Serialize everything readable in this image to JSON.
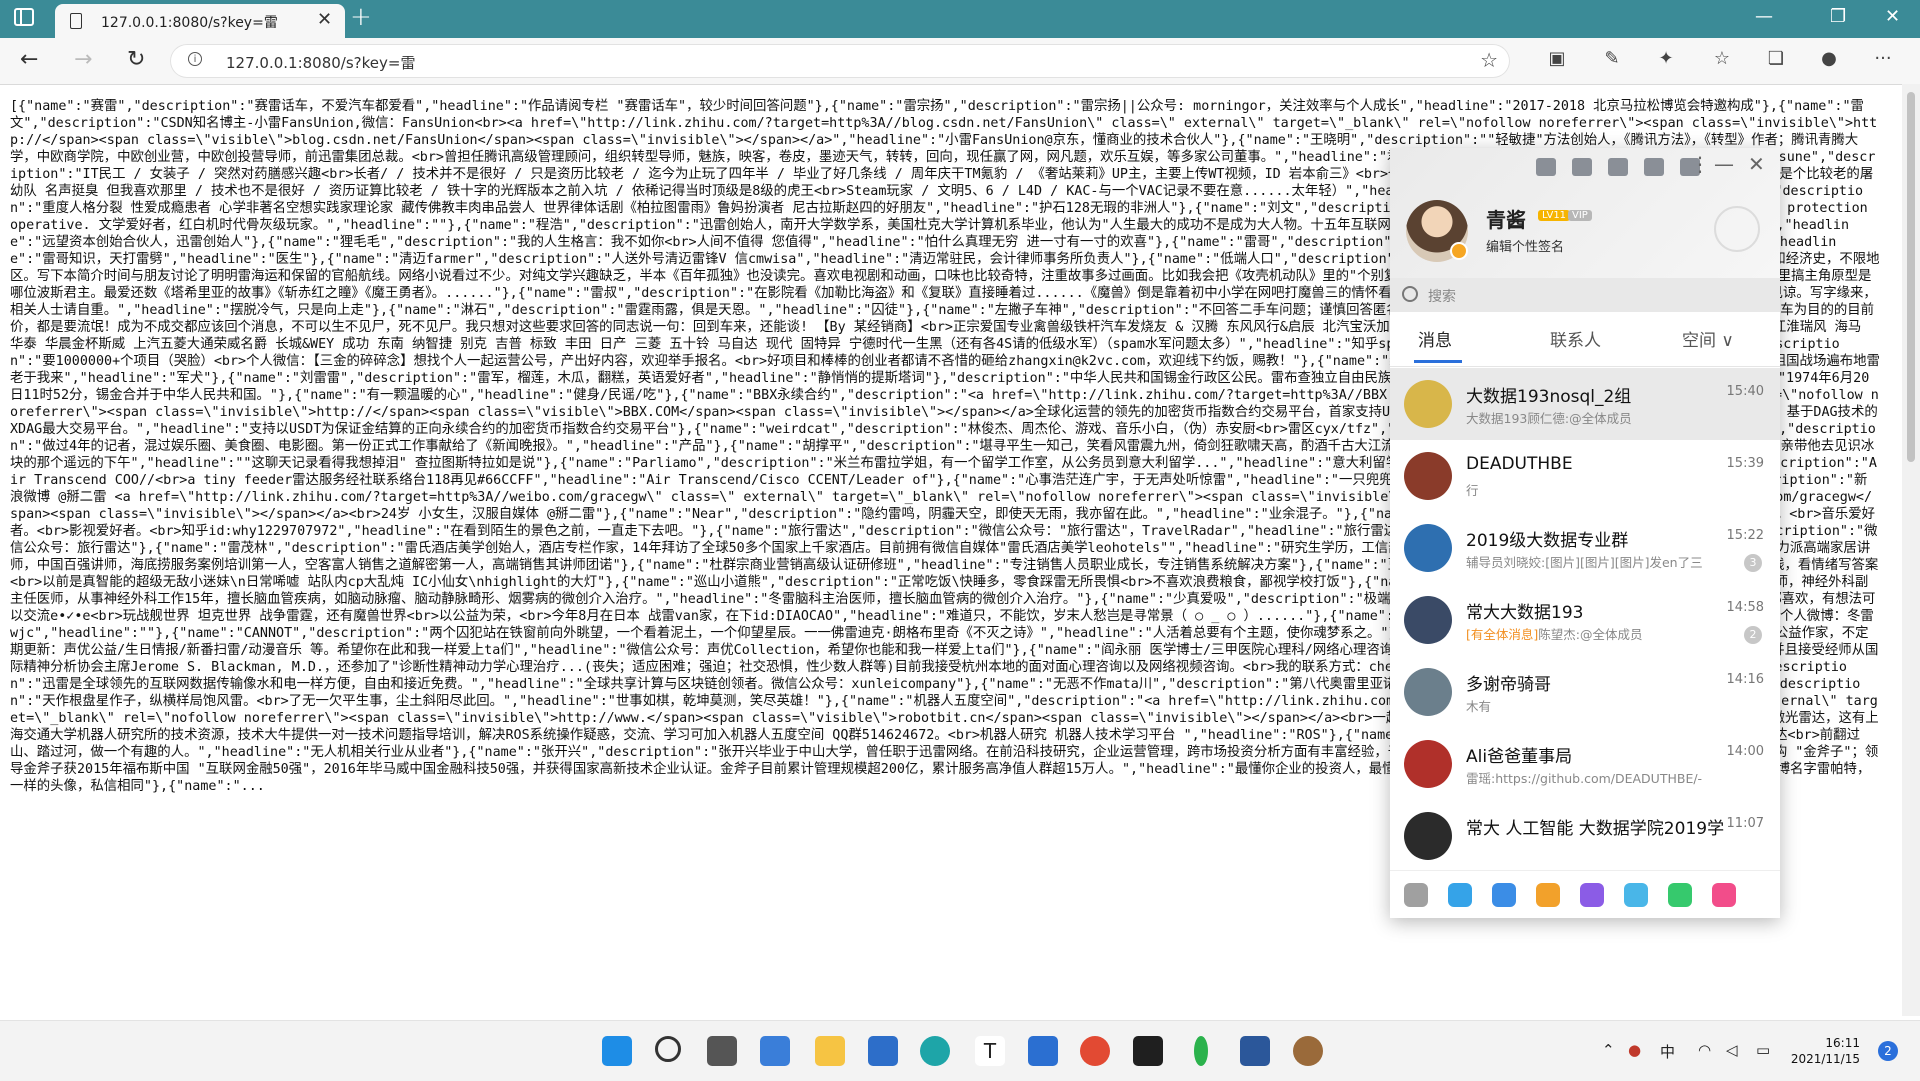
{
  "browser": {
    "tab_title": "127.0.0.1:8080/s?key=雷",
    "tab_close": "✕",
    "new_tab": "+",
    "url": "127.0.0.1:8080/s?key=雷",
    "minimize": "—",
    "maximize": "❐",
    "close": "✕",
    "back": "←",
    "forward": "→",
    "reload": "↻",
    "menu": "···"
  },
  "page": {
    "text": "[{\"name\":\"赛雷\",\"description\":\"赛雷话车，不爱汽车都爱看\",\"headline\":\"作品请阅专栏 \"赛雷话车\"，较少时间回答问题\"},{\"name\":\"雷宗扬\",\"description\":\"雷宗扬||公众号: morningor，关注效率与个人成长\",\"headline\":\"2017-2018 北京马拉松博览会特邀构成\"},{\"name\":\"雷文\",\"description\":\"CSDN知名博主-小雷FansUnion,微信：FansUnion<br><a href=\\\"http://link.zhihu.com/?target=http%3A//blog.csdn.net/FansUnion\\\" class=\\\" external\\\" target=\\\"_blank\\\" rel=\\\"nofollow noreferrer\\\"><span class=\\\"invisible\\\">http://</span><span class=\\\"visible\\\">blog.csdn.net/FansUnion</span><span class=\\\"invisible\\\"></span></a>\",\"headline\":\"小雷FansUnion@京东，懂商业的技术合伙人\"},{\"name\":\"王晓明\",\"description\":\"\"轻敏捷\"方法创始人，《腾讯方法》，《转型》作者；腾讯青腾大学，中欧商学院，中欧创业营，中欧创投营导师，前迅雷集团总裁。<br>曾担任腾讯高级管理顾问，组织转型导师，魅族，映客，卷皮，墨迹天气，转转，回向，现任赢了网，网凡题，欢乐互娱，等多家公司董事。\",\"headline\":\"君武资本 创始人，敏思特咨询 创始人\"},{\"name\":\"SandoKitsune\",\"description\":\"IT民工 / 女装子 / 突然对药膳感兴趣<br>长者/ / 技术并不是很好 / 只是资历比较老 / 迄今为止玩了四年半 / 毕业了好几条线 / 周年庆干TM氪豹 / 《奢站莱莉》UP主，主要上传WT视频，ID 岩本俞三》<br>也玩WOT / 南区北区都有号 / 南区KSAAC战队招募员 / 少先队是个比较老的屠幼队 名声挺臭 但我喜欢那里 / 技术也不是很好 / 资历证算比较老 / 铁十字的光辉版本之前入坑 / 依稀记得当时顶级是8级的虎王<br>Steam玩家 / 文明5、6 / L4D / KAC-与一个VAC记录不要在意......太年轻）\",\"headline\":\"网络工程师、女装子、WT玩家\"},{\"name\":\"拉兹\",\"description\":\"重度人格分裂 性爱成瘾患者 心学非著名空想实践家理论家 藏传佛教丰肉串品尝人 世界律体话剧《柏拉图雷雨》鲁妈扮演者 尼古拉斯赵四的好朋友\",\"headline\":\"护石128无瑕的非洲人\"},{\"name\":\"刘文\",\"description\":\"工程博士，力量举爱好者，巴西柔术蓝带，格雷西巴西柔术 protection operative. 文学爱好者，红白机时代骨灰级玩家。\",\"headline\":\"\"},{\"name\":\"程浩\",\"description\":\"迅雷创始人，南开大学数学系，美国杜克大学计算机系毕业，他认为\"人生最大的成功不是成为大人物。十五年互联网经验，现在从事科技行业的风险投资，目标打造下一支\"红杉\"。\",\"headline\":\"远望资本创始合伙人，迅雷创始人\"},{\"name\":\"狸毛毛\",\"description\":\"我的人生格言：我不如你<br>人间不值得 您值得\",\"headline\":\"怕什么真理无穷 进一寸有一寸的欢喜\"},{\"name\":\"雷哥\",\"description\":\"追求风一样自由，追求雨一样的任性，追求雷一样的轰鸣。\",\"headline\":\"雷哥知识，天打雷劈\",\"headline\":\"医生\"},{\"name\":\"清迈farmer\",\"description\":\"人送外号清迈雷锋V 信cmwisa\",\"headline\":\"清迈常驻民，会计律师事务所负责人\"},{\"name\":\"低端人口\",\"description\":\"半死不活，过几年玩科学和科幻世界。较偏好制度史，边疆史和经济史，不限地区。写下本简介时间与朋友讨论了明明雷海运和保留的官船航线。网络小说看过不少。对纯文学兴趣缺乏，半本《百年孤独》也没读完。喜欢电视剧和动画，口味也比较奇特，注重故事多过画面。比如我会把《攻壳机动队》里的\"个别复杂\"行为和现实中的 \"独狼\"袭击作类比，会在《亚尔斯兰战记》里搞主角原型是哪位波斯君主。最爱还数《塔希里亚的故事》《斩赤红之瞳》《魔王勇者》。......",
    "text2": "\"},{\"name\":\"雷叔\",\"description\":\"在影院看《加勒比海盗》和《复联》直接睡着过......《魔兽》倒是靠着初中小学在网吧打魔兽三的情怀看完了。<br>        本人说真的，想到哪写到哪，文白夹杂，见谅。写字缘来，相关人士请自重。\",\"headline\":\"摆脱冷气，只是向上走\"},{\"name\":\"淋石\",\"description\":\"雷霆雨露，俱是天恩。\",\"headline\":\"囚徒\"},{\"name\":\"左撇子车神\",\"description\":\"不回答二手车问题；谨慎回答匿名提问；别乱邀请我回答问题哈哈\",\"headline\":\"自目前为止订车为目的的目前价，都是要流氓！成为不成交都应该回个消息，不可以生不见尸，死不见尸。我只想对这些要求回答的同志说一句：回到车来，还能谈! 【By 某经销商】<br>正宗爱国专业禽兽级铁杆汽车发烧友 & 汉腾 东风风行&启辰 北汽宝沃加速威望欧美 吉利&领克 长安&DS 比亚迪&腾势 传祺 川汽野马 江淮瑞风 海马 华泰 华晨金杯斯威 上汽五菱大通荣威名爵 长城&WEY 成功 东南 纳智捷 别克 吉普 标致 丰田 日产 三菱 五十铃 马自达 现代 固特异 宁德时代一生黑（还有各4S请的低级水军）（spam水军问题太多）\",\"headline\":\"知乎spam清道夫，被上汽公关怼封号好几次\"},{\"name\":\"张森\",\"description\":\"要1000000+个项目（哭脸）<br>个人微信：【三金的碎碎念】想找个人一起运营公号，产出好内容，欢迎举手报名。<br>好项目和棒棒的创业者都请不吝惜的砸给zhangxin@k2vc.com，欢迎线下约饭，赐教！\"},{\"name\":\"维尼\",\"description\":\"图私和前线铺满黄金孙子才去<br>为祖国战场遍布地雷老于我来\",\"headline\":\"军犬\"},{\"name\":\"刘雷雷\",\"description\":\"雷军，榴莲，木瓜，翻糕，英语爱好者\",\"headline\":\"静悄悄的提斯塔词\"},\"description\":\"中华人民共和国锡金行政区公民。雷布查独立自由民族复兴党党员。Jarnail Singh Bhindranwal\",\"headline\":\"1974年6月20日11时52分，锡金合并于中华人民共和国。\"},{\"name\":\"有一颗温暖的心\",\"headline\":\"健身/民谣/吃\"},{\"name\":\"BBX永续合约\",\"description\":\"<a href=\\\"http://link.zhihu.com/?target=http%3A//BBX.COM\\\" class=\\\" external\\\" target=\\\"_blank\\\" rel=\\\"nofollow noreferrer\\\"><span class=\\\"invisible\\\">http://</span><span class=\\\"visible\\\">BBX.COM</span><span class=\\\"invisible\\\"></span></a>全球化运营的领先的加密货币指数合约交易平台，首家支持USDT做为保证金的币种永续合约交易平台。同时也是迅雷链克LTK、基于DAG技术的XDAG最大交易平台。\",\"headline\":\"支持以USDT为保证金结算的正向永续合约的加密货币指数合约交易平台\"},{\"name\":\"weirdcat\",\"description\":\"林俊杰、周杰伦、游戏、音乐小白，（伪）赤安厨<br>雷区cyx/tfz\",\"headline\":\"林吹/打粉/拉吹/透厨\"},{\"name\":\"晓云coco\",\"description\":\"做过4年的记者，混过娱乐圈、美食圈、电影圈。第一份正式工作事献给了《新闻晚报》。\",\"headline\":\"产品\"},{\"name\":\"胡撑平\",\"description\":\"堪寻平生一知己，笑看风雷震九州，倚剑狂歌啸天高，酌酒千古大江流。\"},{\"name\":\"柏林，奥里雷亚诺.布恩迪亚上校将会回想起父亲带他去见识冰块的那个遥远的下午\",\"headline\":\"\"这聊天记录看得我想掉泪\" 查拉图斯特拉如是说\"},{\"name\":\"Parliamo\",\"description\":\"米兰布雷拉学姐，有一个留学工作室，从公务员到意大利留学...\",\"headline\":\"意大利留学|图兰朵计划|马可波罗计划|国际生\"},{\"name\":\"cyq\",\"description\":\"Air Transcend COO//<br>a tiny feeder雷达服务经社联系络台118再见#66CCFF\",\"headline\":\"Air Transcend/Cisco CCENT/Leader of\"},{\"name\":\"心事浩茫连广宇，于无声处听惊雷\",\"headline\":\"一只兜兜转转实现了人生梦想的理工文青\"},{\"name\":\"掰二雷\",\"description\":\"新浪微博 @掰二雷 <a href=\\\"http://link.zhihu.com/?target=http%3A//weibo.com/gracegw\\\" class=\\\" external\\\" target=\\\"_blank\\\" rel=\\\"nofollow noreferrer\\\"><span class=\\\"invisible\\\">http://</span><span class=\\\"visible\\\">weibo.com/gracegw</span><span class=\\\"invisible\\\"></span></a><br>24岁 小女生，汉服自媒体 @掰二雷\"},{\"name\":\"Near\",\"description\":\"隐约雷鸣，阴霾天空，即使天无雨，我亦留在此。\",\"headline\":\"业余混子。\"},{\"name\":\"子逸\",\"description\":\"在校大学生。<br>科技爱好者。<br>音乐爱好者。<br>影视爱好者。<br>知乎id:why1229707972\",\"headline\":\"在看到陌生的景色之前，一直走下去吧。\"},{\"name\":\"旅行雷达\",\"description\":\"微信公众号：\"旅行雷达\"，TravelRadar\",\"headline\":\"旅行雷达 | 我们是 旅行版什么值得买\"},{\"name\":\"旅行雷达\",\"description\":\"微信公众号：旅行雷达\"},{\"name\":\"雷茂林\",\"description\":\"雷氏酒店美学创始人，酒店专栏作家，14年拜访了全球50多个国家上千家酒店。目前拥有微信自媒体\"雷氏酒店美学leohotels\"\",\"headline\":\"研究生学历，工信部国家创业辅导师，资深销售讲师与顾问，资深服务营销讲师，实力派高端家居讲师，中国百强讲师，海底捞服务案例培训第一人，空客富人销售之道解密第一人，高端销售其讲师团诺\"},{\"name\":\"杜群宗商业营销高级认证研修班\",\"headline\":\"专注销售人员职业成长，专注销售系统解决方案\"},{\"name\":\"豆状况\",\"description\":\"狗哥哥的一只大三狗<br>按心情上线，看情绪写答案<br>以前是真智能的超级无敌小迷妹\\n日常唏嘘 站队内cp大乱炖 IC小仙女\\nhighlight的大灯\"},{\"name\":\"巡山小道熊\",\"description\":\"正常吃饭\\快睡多，零食踩雷无所畏惧<br>不喜欢浪费粮食，鄙视学校打饭\"},{\"name\":\"冬雷脑科主治医生\",\"description\":\"冬雷脑科核心医师，神经外科副主任医师，从事神经外科工作15年，擅长脑血管疾病，如脑动脉瘤、脑动静脉畸形、烟雾病的微创介入治疗。\",\"headline\":\"冬雷脑科主治医师，擅长脑血管病的微创介入治疗。\"},{\"name\":\"少真爱吸\",\"description\":\"极端喜欢音乐：流行乐 古典乐 民谣 交响曲 小提琴独奏 钢琴曲 ~都喜欢，有想法可以交流e•✓•e<br>玩战舰世界 坦克世界 战争雷霆，还有魔兽世界<br>以公益为荣，<br>今年8月在日本 战雷van家，在下id:DIAOCAO\",\"headline\":\"难道只，不能饮，岁末人愁岂是寻常景（ ○ _ ○ ）......\"},{\"name\":\"王语咒\",\"description\":\"文学爱好者，好读书，不求甚解。个人微博：冬雷wjc\",\"headline\":\"\"},{\"name\":\"CANNOT\",\"description\":\"两个囚犯站在铁窗前向外眺望，一个看着泥土，一个仰望星辰。一一佛雷迪克·朗格布里奇《不灭之诗》\",\"headline\":\"人活着总要有个主题，使你魂梦系之。\"},{\"name\":\"川声\",\"description\":\"纸片党，文字控，声优公益作家，不定期更新：声优公益/生日情报/新番扫雷/动漫音乐 等。希望你在此和我一样爱上ta们\",\"headline\":\"微信公众号：声优Collection，希望你也能和我一样爱上ta们\"},{\"name\":\"阎永丽 医学博士/三甲医院心理科/网络心理咨询师\",\"description\":\"师从新武汉忠德心理医院院长雷正刚，并且接受经师从国际精神分析协会主席Jerome S. Blackman, M.D.，还参加了\"诊断性精神动力学心理治疗...(丧失；适应困难；强迫；社交恐惧，性少数人群等)目前我接受杭州本地的面对面心理咨询以及网络视频咨询。<br>我的联系方式：cheri2008@163.com\",\"headline\":\"\"},{\"name\":\"迅雷\",\"description\":\"迅雷是全球领先的互联网数据传输像水和电一样方便，自由和接近免费。\",\"headline\":\"全球共享计算与区块链创领者。微信公众号：xunleicompany\"},{\"name\":\"无恶不作mata川\",\"description\":\"第八代奥雷里亚诺·布恩迪亚\"},{\"name\":\"天作根盘星作子，纵横样局饱风雷\",\"description\":\"天作根盘星作子，纵横样局饱风雷。<br>了无一欠平生事，尘土斜阳尽此回。\",\"headline\":\"世事如棋，乾坤莫测，笑尽英雄！\"},{\"name\":\"机器人五度空间\",\"description\":\"<a href=\\\"http://link.zhihu.com/?target=http%3A//www.robotbit.cn\\\" class=\\\" external\\\" target=\\\"_blank\\\" rel=\\\"nofollow noreferrer\\\"><span class=\\\"invisible\\\">http://www.</span><span class=\\\"visible\\\">robotbit.cn</span><span class=\\\"invisible\\\"></span></a><br>一起学习机器人系统，机器人五度空间这里有机器人ROS学习平台、激光雷达，这有上海交通大学机器人研究所的技术资源，技术大牛提供一对一技术问题指导培训，解决ROS系统操作疑惑，交流、学习可加入机器人五度空间 QQ群514624672。<br>机器人研究 机器人技术学习平台 \",\"headline\":\"ROS\"},{\"name\":\"Eric\",\"description\":\"现从事无人机行业，机载激光雷达<br>前翻过山、踏过河，做一个有趣的人。\",\"headline\":\"无人机相关行业从业者\"},{\"name\":\"张开兴\",\"description\":\"张开兴毕业于中山大学，曾任职于迅雷网络。在前沿科技研究，企业运营管理，跨市场投资分析方面有丰富经验，于2012年创立 \"数据与科技驱动型\" 财富管理&amp;资产管理机构 \"金斧子\"；领导金斧子获2015年福布斯中国 \"互联网金融50强\"，2016年毕马威中国金融科技50强，并获得国家高新技术企业认证。金斧子目前累计管理规模超200亿，累计服务高净值人群超15万人。\",\"headline\":\"最懂你企业的投资人，最懂投资的创业者。\"},{\"name\":\"雷帕特\",\"description\":\"微博名字雷帕特，一样的头像，私信相同\"},{\"name\":\"..."
  },
  "qq": {
    "username": "青酱",
    "badge_level": "LV11",
    "badge_vip": "VIP",
    "signature": "编辑个性签名",
    "search_placeholder": "搜索",
    "tabs": [
      "消息",
      "联系人",
      "空间 ∨"
    ],
    "conversations": [
      {
        "name": "大数据193nosql_2组",
        "sub": "大数据193顾仁德:@全体成员",
        "time": "15:40",
        "count": "",
        "sub_highlight": "",
        "color": "#d8b64a"
      },
      {
        "name": "DEADUTHBE",
        "sub": "行",
        "time": "15:39",
        "count": "",
        "sub_highlight": "",
        "color": "#8a3b2a"
      },
      {
        "name": "2019级大数据专业群",
        "sub": "辅导员刘晓姣:[图片][图片][图片]发en了三",
        "time": "15:22",
        "count": "3",
        "sub_highlight": "",
        "color": "#2e6fb0"
      },
      {
        "name": "常大大数据193",
        "sub": "陈望杰:@全体成员",
        "time": "14:58",
        "count": "2",
        "sub_highlight": "[有全体消息]",
        "color": "#3a4a66"
      },
      {
        "name": "多谢帝骑哥",
        "sub": "木有",
        "time": "14:16",
        "count": "",
        "sub_highlight": "",
        "color": "#6b7f8c"
      },
      {
        "name": "Ali爸爸董事局",
        "sub": "雷瑶:https://github.com/DEADUTHBE/-",
        "time": "14:00",
        "count": "",
        "sub_highlight": "",
        "color": "#b0302a"
      },
      {
        "name": "常大 人工智能 大数据学院2019学",
        "sub": "",
        "time": "11:07",
        "count": "",
        "sub_highlight": "",
        "color": "#2b2b2b"
      }
    ]
  },
  "taskbar": {
    "ime": "中",
    "time": "16:11",
    "date": "2021/11/15",
    "notifications": "2",
    "app_letter": "T"
  }
}
